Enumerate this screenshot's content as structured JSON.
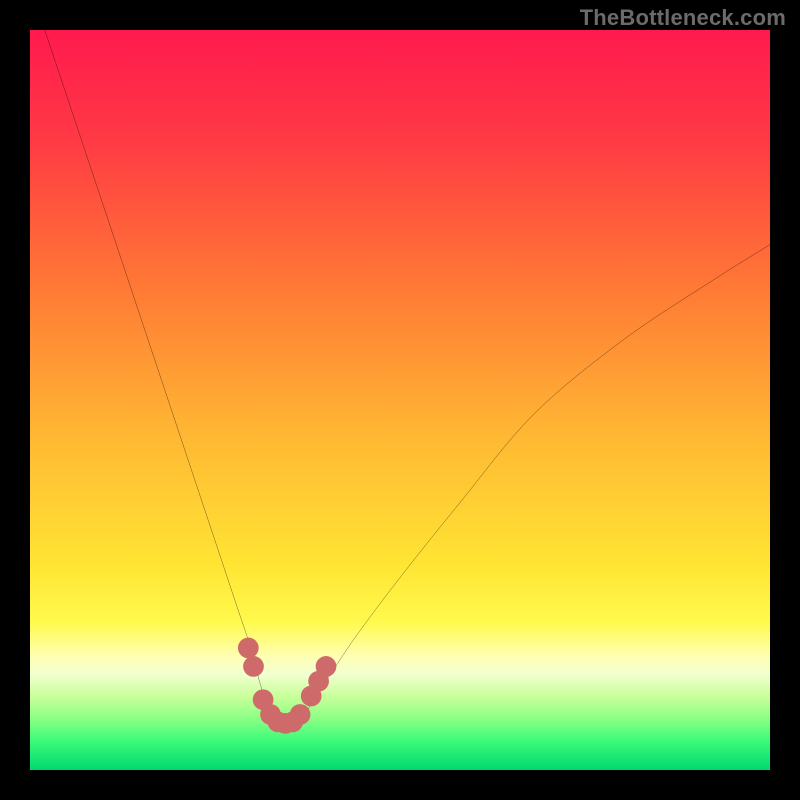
{
  "watermark": {
    "text": "TheBottleneck.com"
  },
  "colors": {
    "black": "#000000",
    "curve": "#000000",
    "marker": "#cf6a6a",
    "gradient_stops": [
      {
        "offset": 0.0,
        "color": "#ff1a4e"
      },
      {
        "offset": 0.15,
        "color": "#ff3a44"
      },
      {
        "offset": 0.35,
        "color": "#ff7a35"
      },
      {
        "offset": 0.55,
        "color": "#ffb833"
      },
      {
        "offset": 0.72,
        "color": "#ffe433"
      },
      {
        "offset": 0.8,
        "color": "#fff94d"
      },
      {
        "offset": 0.845,
        "color": "#ffffb0"
      },
      {
        "offset": 0.87,
        "color": "#f2ffd0"
      },
      {
        "offset": 0.9,
        "color": "#c9ff9a"
      },
      {
        "offset": 0.93,
        "color": "#8cff85"
      },
      {
        "offset": 0.96,
        "color": "#3dfb7a"
      },
      {
        "offset": 1.0,
        "color": "#00d86f"
      }
    ]
  },
  "chart_data": {
    "type": "line",
    "title": "",
    "xlabel": "",
    "ylabel": "",
    "xlim": [
      0,
      100
    ],
    "ylim": [
      0,
      100
    ],
    "series": [
      {
        "name": "bottleneck-curve",
        "x": [
          2,
          6,
          10,
          14,
          18,
          22,
          26,
          28,
          30,
          31,
          32,
          33,
          34,
          35,
          36,
          37,
          38,
          40,
          44,
          50,
          58,
          68,
          80,
          92,
          100
        ],
        "y": [
          100,
          88,
          76,
          64,
          52,
          40,
          28,
          22,
          16,
          12,
          9,
          7,
          6,
          6,
          6,
          7,
          9,
          12,
          18,
          26,
          36,
          48,
          58,
          66,
          71
        ]
      }
    ],
    "markers": {
      "name": "highlight-dots",
      "x": [
        29.5,
        30.2,
        31.5,
        32.5,
        33.5,
        34.5,
        35.5,
        36.5,
        38.0,
        39.0,
        40.0
      ],
      "y": [
        16.5,
        14.0,
        9.5,
        7.5,
        6.5,
        6.3,
        6.5,
        7.5,
        10.0,
        12.0,
        14.0
      ],
      "r": 1.4
    }
  }
}
